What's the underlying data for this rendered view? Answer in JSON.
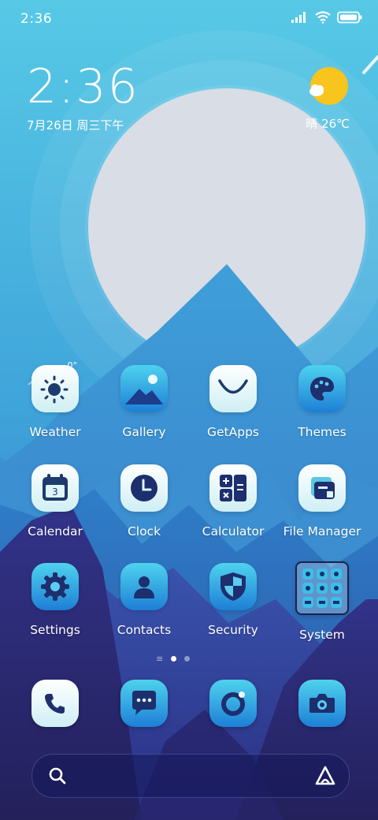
{
  "status_bar": {
    "time": "2:36",
    "icons": [
      "signal-icon",
      "wifi-icon",
      "battery-icon"
    ]
  },
  "clock_widget": {
    "time": "2:36",
    "date": "7月26日 周三下午"
  },
  "weather_widget": {
    "condition": "晴",
    "temperature": "26℃",
    "icon": "sun-cloud-icon"
  },
  "apps": [
    {
      "label": "Weather",
      "icon": "weather-sun-icon"
    },
    {
      "label": "Gallery",
      "icon": "gallery-icon"
    },
    {
      "label": "GetApps",
      "icon": "getapps-icon"
    },
    {
      "label": "Themes",
      "icon": "palette-icon"
    },
    {
      "label": "Calendar",
      "icon": "calendar-icon",
      "badge": "3"
    },
    {
      "label": "Clock",
      "icon": "clock-icon"
    },
    {
      "label": "Calculator",
      "icon": "calculator-icon"
    },
    {
      "label": "File Manager",
      "icon": "folder-icon"
    },
    {
      "label": "Settings",
      "icon": "gear-icon"
    },
    {
      "label": "Contacts",
      "icon": "person-icon"
    },
    {
      "label": "Security",
      "icon": "shield-icon"
    },
    {
      "label": "System",
      "icon": "folder-grid-icon"
    }
  ],
  "page_indicator": {
    "pages": 2,
    "current": 1
  },
  "dock": [
    {
      "name": "phone",
      "icon": "phone-icon"
    },
    {
      "name": "messages",
      "icon": "message-icon"
    },
    {
      "name": "browser",
      "icon": "browser-icon"
    },
    {
      "name": "camera",
      "icon": "camera-icon"
    }
  ],
  "search_bar": {
    "left_icon": "search-icon",
    "right_icon": "assistant-icon"
  },
  "colors": {
    "sky_top": "#57c9e6",
    "sky_mid": "#3fa9dd",
    "mountain_dark": "#2b2a72",
    "sun": "#d9dde5",
    "weather_sun": "#f7c51d"
  }
}
